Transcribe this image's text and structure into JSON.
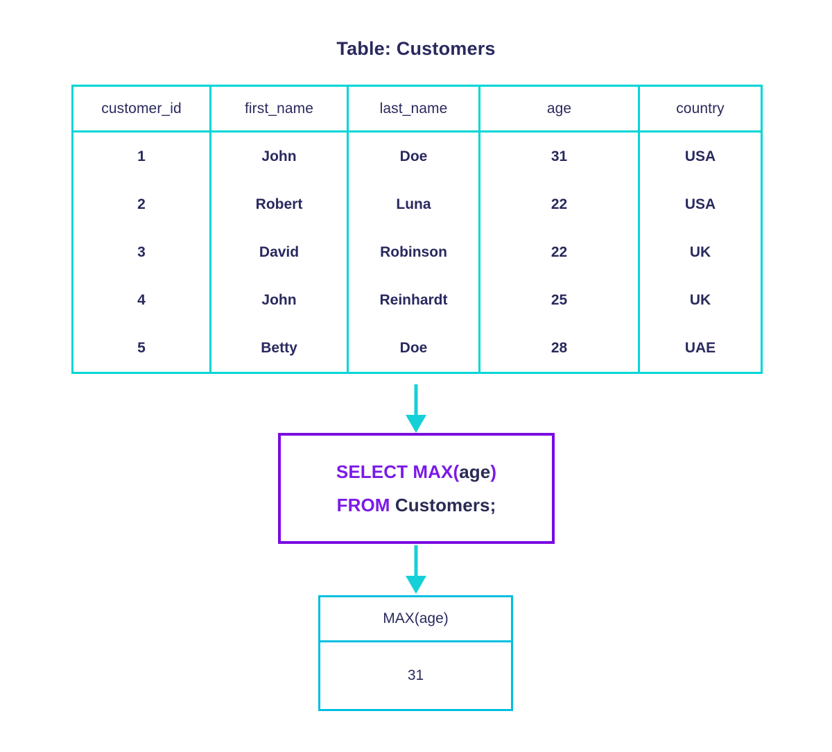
{
  "title": "Table: Customers",
  "source_table": {
    "name": "Customers",
    "columns": [
      "customer_id",
      "first_name",
      "last_name",
      "age",
      "country"
    ],
    "rows": [
      [
        "1",
        "John",
        "Doe",
        "31",
        "USA"
      ],
      [
        "2",
        "Robert",
        "Luna",
        "22",
        "USA"
      ],
      [
        "3",
        "David",
        "Robinson",
        "22",
        "UK"
      ],
      [
        "4",
        "John",
        "Reinhardt",
        "25",
        "UK"
      ],
      [
        "5",
        "Betty",
        "Doe",
        "28",
        "UAE"
      ]
    ]
  },
  "query": {
    "line1": {
      "keyword_prefix": "SELECT MAX(",
      "identifier": "age",
      "keyword_suffix": ")"
    },
    "line2": {
      "keyword_prefix": "FROM ",
      "identifier": "Customers;",
      "keyword_suffix": ""
    },
    "full_text": "SELECT MAX(age) FROM Customers;"
  },
  "result_table": {
    "columns": [
      "MAX(age)"
    ],
    "rows": [
      [
        "31"
      ]
    ]
  },
  "arrows": [
    {
      "name": "table-to-query-arrow",
      "from": "source-table",
      "to": "sql-box"
    },
    {
      "name": "query-to-result-arrow",
      "from": "sql-box",
      "to": "result-table"
    }
  ],
  "colors": {
    "table_border": "#00d5d5",
    "result_border": "#00bfe0",
    "query_border": "#7b0ae0",
    "keyword": "#7b1ae8",
    "identifier": "#2b2b55",
    "text": "#29295e",
    "arrow": "#16d0d8",
    "background": "#ffffff"
  }
}
